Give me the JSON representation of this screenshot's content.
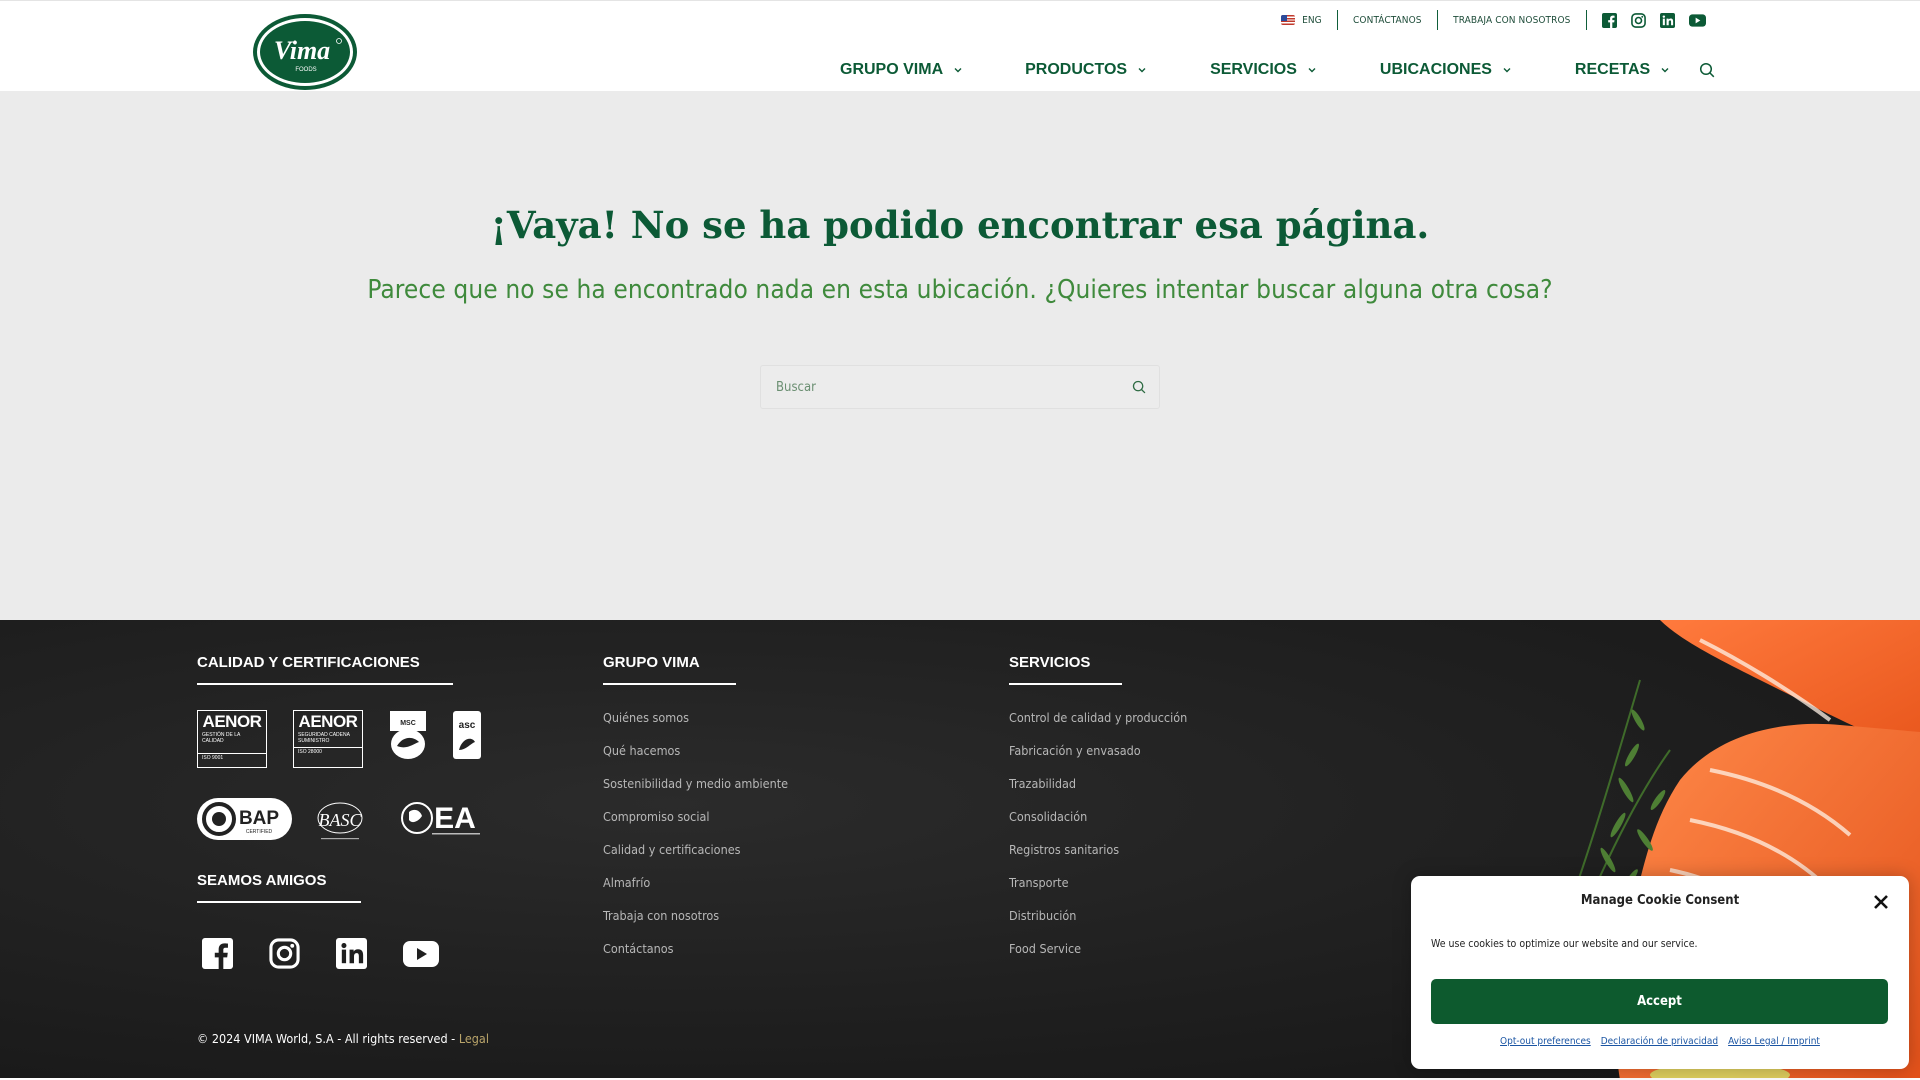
{
  "header": {
    "logo_text": "Vima",
    "logo_subtext": "FOODS",
    "topbar": {
      "lang_label": "ENG",
      "contact_label": "CONTÁCTANOS",
      "work_label": "TRABAJA CON NOSOTROS",
      "social_icons": [
        "facebook-icon",
        "instagram-icon",
        "linkedin-icon",
        "youtube-icon"
      ]
    },
    "nav": [
      {
        "label": "GRUPO VIMA"
      },
      {
        "label": "PRODUCTOS"
      },
      {
        "label": "SERVICIOS"
      },
      {
        "label": "UBICACIONES"
      },
      {
        "label": "RECETAS"
      }
    ]
  },
  "main": {
    "title": "¡Vaya! No se ha podido encontrar esa página.",
    "subtitle": "Parece que no se ha encontrado nada en esta ubicación. ¿Quieres intentar buscar alguna otra cosa?",
    "search_placeholder": "Buscar"
  },
  "footer": {
    "certs_heading": "CALIDAD Y CERTIFICACIONES",
    "certs": {
      "aenor1_big": "AENOR",
      "aenor1_small": "GESTIÓN DE LA CALIDAD",
      "aenor1_code": "ISO 9001",
      "aenor2_big": "AENOR",
      "aenor2_small": "SEGURIDAD CADENA SUMINISTRO",
      "aenor2_code": "ISO 28000",
      "msc_text": "MSC",
      "asc_text": "asc",
      "bap_text": "BAP",
      "bap_sub": "CERTIFIED",
      "basc_text": "BASC",
      "ea_text": "EA"
    },
    "friends_heading": "SEAMOS AMIGOS",
    "group_heading": "GRUPO VIMA",
    "group_links": [
      "Quiénes somos",
      "Qué hacemos",
      "Sostenibilidad y medio ambiente",
      "Compromiso social",
      "Calidad y certificaciones",
      "Almafrío",
      "Trabaja con nosotros",
      "Contáctanos"
    ],
    "services_heading": "SERVICIOS",
    "services_links": [
      "Control de calidad y producción",
      "Fabricación y envasado",
      "Trazabilidad",
      "Consolidación",
      "Registros sanitarios",
      "Transporte",
      "Distribución",
      "Food Service"
    ],
    "copyright": "© 2024 VIMA World, S.A - All rights reserved -",
    "legal_link": "Legal"
  },
  "cookie": {
    "title": "Manage Cookie Consent",
    "text": "We use cookies to optimize our website and our service.",
    "accept_label": "Accept",
    "links": [
      "Opt-out preferences",
      "Declaración de privacidad",
      "Aviso Legal / Imprint"
    ]
  },
  "colors": {
    "brand_green": "#0c5a36",
    "subtitle_green": "#3f8a3c",
    "accept_green": "#0d5a2e"
  }
}
